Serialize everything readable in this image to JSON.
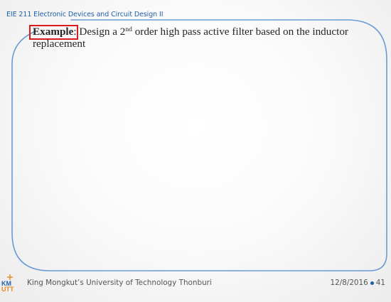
{
  "header": {
    "course_title": "EIE 211 Electronic Devices and Circuit Design II"
  },
  "content": {
    "label": "Example",
    "separator": ": ",
    "text_before_sup": "Design a 2",
    "sup": "nd",
    "text_after_sup": " order high pass active filter based on the inductor replacement"
  },
  "footer": {
    "logo_text": "KMUTT",
    "institution": "King Mongkut’s University of Technology Thonburi",
    "date": "12/8/2016",
    "page_number": "41"
  },
  "colors": {
    "header_text": "#1f5fa8",
    "frame_stroke": "#6b9bd3",
    "highlight_box": "#d91b1b",
    "logo_orange": "#e08a1e",
    "logo_blue": "#1f5fa8"
  }
}
